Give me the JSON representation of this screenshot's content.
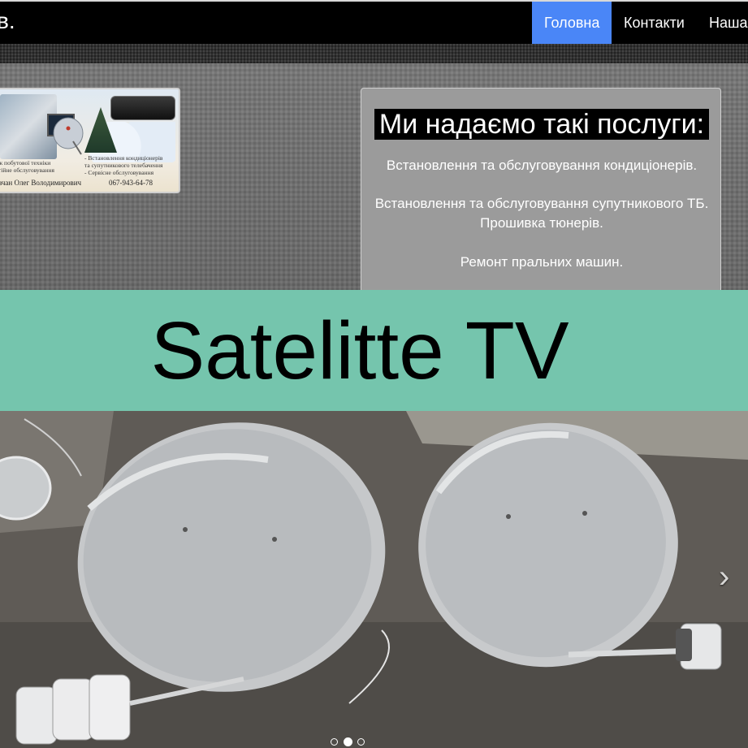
{
  "navbar": {
    "brand": "в.",
    "items": [
      {
        "label": "Головна",
        "active": true
      },
      {
        "label": "Контакти",
        "active": false
      },
      {
        "label": "Наша",
        "active": false
      }
    ],
    "active_color": "#4a86f7"
  },
  "card": {
    "services_right": [
      "- Встановлення кондиціонерів",
      "та супутникового телебачення",
      "- Сервісне обслуговування"
    ],
    "services_left": [
      "ж побутової техніки",
      "тійне обслуговування"
    ],
    "name": "вчан Олег Володимирович",
    "phone": "067-943-64-78"
  },
  "services": {
    "title": "Ми надаємо такі послуги:",
    "items": [
      "Встановлення та обслуговування кондиціонерів.",
      "Встановлення та обслуговування супутникового ТБ. Прошивка тюнерів.",
      "Ремонт пральних машин."
    ]
  },
  "banner": {
    "text": "Satelitte TV",
    "color": "#75c5ad"
  },
  "carousel": {
    "next_icon": "chevron-right-icon",
    "slides": 3,
    "active_slide": 2
  }
}
